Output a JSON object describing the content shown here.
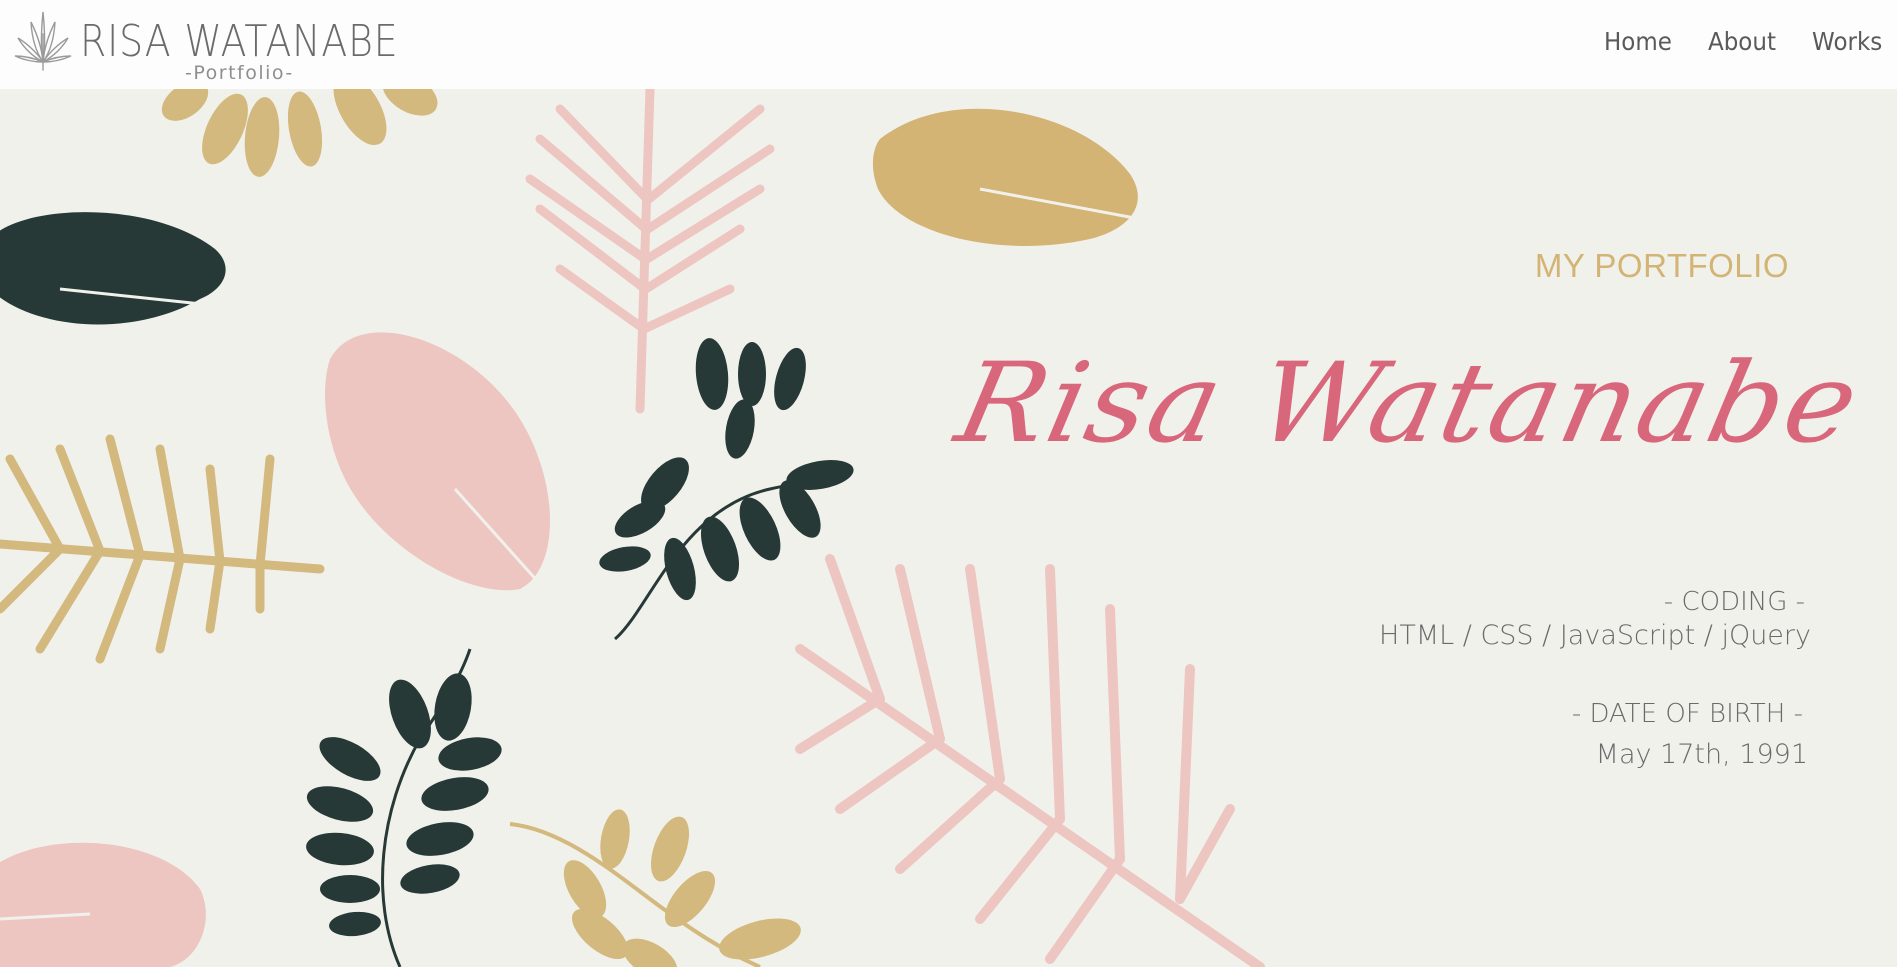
{
  "header": {
    "logo_title": "RISA WATANABE",
    "logo_subtitle": "-Portfolio-",
    "logo_icon": "leaf-icon",
    "nav": [
      {
        "label": "Home"
      },
      {
        "label": "About"
      },
      {
        "label": "Works"
      }
    ]
  },
  "hero": {
    "label": "MY PORTFOLIO",
    "signature": "Risa Watanabe",
    "coding_heading": "- CODING -",
    "coding_value": "HTML / CSS / JavaScript / jQuery",
    "dob_heading": "- DATE OF BIRTH -",
    "dob_value": "May 17th, 1991"
  },
  "colors": {
    "background": "#f1f1ec",
    "header_background": "#fdfdfd",
    "gold": "#d3b474",
    "pink_leaf": "#eec6c1",
    "dark_green": "#263937",
    "signature_pink": "#d9677c",
    "text_gray": "#6a6a6a"
  }
}
